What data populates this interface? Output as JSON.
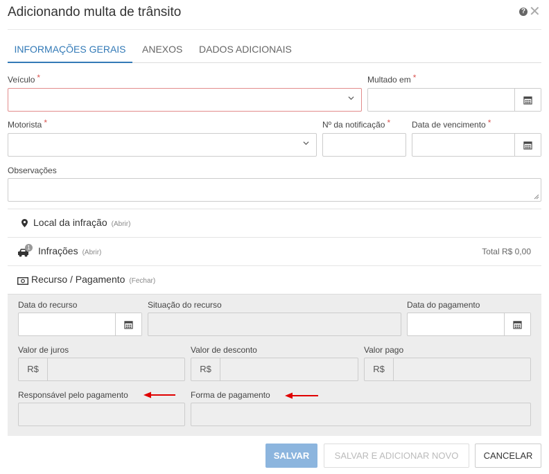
{
  "dialog": {
    "title": "Adicionando multa de trânsito",
    "help_glyph": "?",
    "close_glyph": "✕"
  },
  "tabs": [
    {
      "label": "INFORMAÇÕES GERAIS",
      "active": true
    },
    {
      "label": "ANEXOS",
      "active": false
    },
    {
      "label": "DADOS ADICIONAIS",
      "active": false
    }
  ],
  "form": {
    "veiculo": {
      "label": "Veículo",
      "required_mark": "*",
      "value": ""
    },
    "multado_em": {
      "label": "Multado em",
      "required_mark": "*",
      "value": ""
    },
    "motorista": {
      "label": "Motorista",
      "required_mark": "*",
      "value": ""
    },
    "notificacao": {
      "label": "Nº da notificação",
      "required_mark": "*",
      "value": ""
    },
    "vencimento": {
      "label": "Data de vencimento",
      "required_mark": "*",
      "value": ""
    },
    "observacoes": {
      "label": "Observações",
      "value": ""
    }
  },
  "sections": {
    "local": {
      "title": "Local da infração",
      "hint": "(Abrir)",
      "icon": "map-marker-icon"
    },
    "infracoes": {
      "title": "Infrações",
      "hint": "(Abrir)",
      "icon": "car-icon",
      "badge": "1",
      "total": "Total R$ 0,00"
    },
    "recurso": {
      "title": "Recurso / Pagamento",
      "hint": "(Fechar)",
      "icon": "money-icon"
    }
  },
  "recurso_panel": {
    "data_recurso": {
      "label": "Data do recurso",
      "value": ""
    },
    "situacao_recurso": {
      "label": "Situação do recurso",
      "value": ""
    },
    "data_pagamento": {
      "label": "Data do pagamento",
      "value": ""
    },
    "valor_juros": {
      "label": "Valor de juros",
      "prefix": "R$",
      "value": ""
    },
    "valor_desconto": {
      "label": "Valor de desconto",
      "prefix": "R$",
      "value": ""
    },
    "valor_pago": {
      "label": "Valor pago",
      "prefix": "R$",
      "value": ""
    },
    "responsavel": {
      "label": "Responsável pelo pagamento",
      "value": ""
    },
    "forma_pagamento": {
      "label": "Forma de pagamento",
      "value": ""
    }
  },
  "buttons": {
    "save": "SALVAR",
    "save_new": "SALVAR E ADICIONAR NOVO",
    "cancel": "CANCELAR"
  },
  "colors": {
    "accent": "#337ab7",
    "required": "#d9534f",
    "annotation_arrow": "#e00000",
    "save_button": "#8cb5de"
  }
}
